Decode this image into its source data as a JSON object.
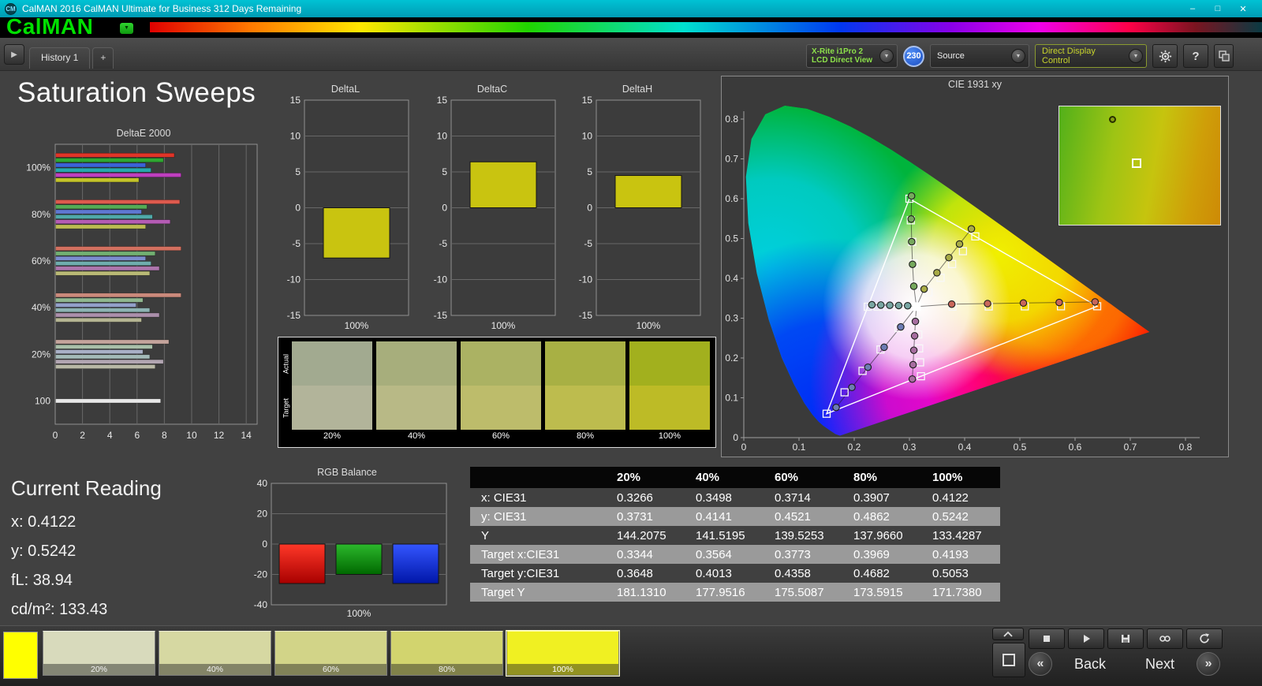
{
  "titlebar": {
    "logo_badge": "CM",
    "title": "CalMAN 2016 CalMAN Ultimate for Business 312 Days Remaining",
    "minimize": "–",
    "maximize": "□",
    "close": "✕"
  },
  "brand": {
    "logo": "CalMAN",
    "menu_arrow": "▼"
  },
  "tabs": {
    "expand_icon": "▶",
    "active": "History 1",
    "add": "+"
  },
  "toolbar": {
    "meter_line1": "X-Rite i1Pro 2",
    "meter_line2": "LCD Direct View",
    "badge": "230",
    "source": "Source",
    "display_control": "Direct Display Control",
    "dropdown_arrow": "▼",
    "help_icon": "?"
  },
  "page_title": "Saturation Sweeps",
  "charts": {
    "deltae": {
      "type": "bar",
      "title": "DeltaE 2000",
      "xticks": [
        0,
        2,
        4,
        6,
        8,
        10,
        12,
        14
      ],
      "xmax": 14.8,
      "groups": [
        {
          "label": "100%",
          "values": [
            8.7,
            7.9,
            6.6,
            7.0,
            9.2,
            6.1
          ],
          "colors": [
            "#e03428",
            "#2fa832",
            "#3b62d8",
            "#27a8ac",
            "#bf3fbf",
            "#c3c32a"
          ]
        },
        {
          "label": "80%",
          "values": [
            9.1,
            6.7,
            6.3,
            7.1,
            8.4,
            6.6
          ],
          "colors": [
            "#de5a4e",
            "#55ab55",
            "#5f78d2",
            "#4fa9a9",
            "#b45cb4",
            "#bcbc52"
          ]
        },
        {
          "label": "60%",
          "values": [
            9.2,
            7.3,
            6.6,
            7.0,
            7.6,
            6.9
          ],
          "colors": [
            "#d3705f",
            "#72b072",
            "#7b8cce",
            "#6fadad",
            "#ad76ad",
            "#b9b975"
          ]
        },
        {
          "label": "40%",
          "values": [
            9.2,
            6.4,
            5.9,
            6.9,
            7.6,
            6.3
          ],
          "colors": [
            "#cb8a7c",
            "#90b790",
            "#93a0ca",
            "#8db3b3",
            "#ab8fab",
            "#b5b593"
          ]
        },
        {
          "label": "20%",
          "values": [
            8.3,
            7.1,
            6.4,
            6.9,
            7.9,
            7.3
          ],
          "colors": [
            "#c4a49c",
            "#a9bfa9",
            "#a8b0c6",
            "#a3bab8",
            "#b2a6b2",
            "#b8b8a6"
          ]
        },
        {
          "label": "100",
          "values": [
            7.7
          ],
          "colors": [
            "#e8e8e8"
          ]
        }
      ]
    },
    "deltaL": {
      "type": "bar",
      "title": "DeltaL",
      "value": -7.0,
      "ylim": [
        -15,
        15
      ],
      "yticks": [
        15,
        10,
        5,
        0,
        -5,
        -10,
        -15
      ],
      "xlabel": "100%",
      "bar_color": "#c9c410"
    },
    "deltaC": {
      "type": "bar",
      "title": "DeltaC",
      "value": 6.4,
      "ylim": [
        -15,
        15
      ],
      "yticks": [
        15,
        10,
        5,
        0,
        -5,
        -10,
        -15
      ],
      "xlabel": "100%",
      "bar_color": "#c9c410"
    },
    "deltaH": {
      "type": "bar",
      "title": "DeltaH",
      "value": 4.5,
      "ylim": [
        -15,
        15
      ],
      "yticks": [
        15,
        10,
        5,
        0,
        -5,
        -10,
        -15
      ],
      "xlabel": "100%",
      "bar_color": "#c9c410"
    },
    "rgb_balance": {
      "type": "bar",
      "title": "RGB Balance",
      "ylim": [
        -40,
        40
      ],
      "yticks": [
        40,
        20,
        0,
        -20,
        -40
      ],
      "xlabel": "100%",
      "bars": [
        {
          "name": "red",
          "value": -26,
          "color_top": "#ff3828",
          "color_bottom": "#a80000"
        },
        {
          "name": "green",
          "value": -20,
          "color_top": "#2cb82c",
          "color_bottom": "#006800"
        },
        {
          "name": "blue",
          "value": -26,
          "color_top": "#3456ff",
          "color_bottom": "#0016a8"
        }
      ]
    }
  },
  "swatch_panel": {
    "row_labels": [
      "Actual",
      "Target"
    ],
    "items": [
      {
        "label": "20%",
        "actual": "#a2aa90",
        "target": "#b2b49a"
      },
      {
        "label": "40%",
        "actual": "#a7ae7c",
        "target": "#b8b986"
      },
      {
        "label": "60%",
        "actual": "#abb263",
        "target": "#bdbc6b"
      },
      {
        "label": "80%",
        "actual": "#a8b044",
        "target": "#bdbc4e"
      },
      {
        "label": "100%",
        "actual": "#a2b01e",
        "target": "#bdbb26"
      }
    ]
  },
  "cie": {
    "title": "CIE 1931 xy",
    "xticks": [
      0,
      0.1,
      0.2,
      0.3,
      0.4,
      0.5,
      0.6,
      0.7,
      0.8
    ],
    "yticks": [
      0,
      0.1,
      0.2,
      0.3,
      0.4,
      0.5,
      0.6,
      0.7,
      0.8
    ],
    "white_point": [
      0.3127,
      0.329
    ],
    "gamut_triangle": [
      [
        0.64,
        0.33
      ],
      [
        0.3,
        0.6
      ],
      [
        0.15,
        0.06
      ]
    ],
    "sweeps": [
      {
        "name": "red",
        "fill": "#c9675b",
        "targets": [
          [
            0.3781,
            0.329
          ],
          [
            0.4436,
            0.3294
          ],
          [
            0.509,
            0.3296
          ],
          [
            0.5745,
            0.3298
          ],
          [
            0.64,
            0.33
          ]
        ],
        "measured": [
          [
            0.3766,
            0.3352
          ],
          [
            0.4415,
            0.3366
          ],
          [
            0.5064,
            0.338
          ],
          [
            0.5713,
            0.3394
          ],
          [
            0.6362,
            0.3408
          ]
        ]
      },
      {
        "name": "green",
        "fill": "#76a95d",
        "targets": [
          [
            0.3102,
            0.3832
          ],
          [
            0.3076,
            0.4374
          ],
          [
            0.3051,
            0.4916
          ],
          [
            0.3025,
            0.5458
          ],
          [
            0.3,
            0.6
          ]
        ],
        "measured": [
          [
            0.3079,
            0.3802
          ],
          [
            0.3056,
            0.4352
          ],
          [
            0.3041,
            0.492
          ],
          [
            0.3032,
            0.549
          ],
          [
            0.3038,
            0.6068
          ]
        ]
      },
      {
        "name": "blue",
        "fill": "#6d7cb4",
        "targets": [
          [
            0.2802,
            0.2752
          ],
          [
            0.2476,
            0.2214
          ],
          [
            0.2151,
            0.1676
          ],
          [
            0.1825,
            0.1138
          ],
          [
            0.15,
            0.06
          ]
        ],
        "measured": [
          [
            0.2842,
            0.278
          ],
          [
            0.2542,
            0.227
          ],
          [
            0.2248,
            0.1768
          ],
          [
            0.1958,
            0.1262
          ],
          [
            0.1672,
            0.0758
          ]
        ]
      },
      {
        "name": "cyan",
        "fill": "#79a6a3",
        "targets": [
          [
            0.2951,
            0.3289
          ],
          [
            0.2775,
            0.3289
          ],
          [
            0.2599,
            0.3288
          ],
          [
            0.2422,
            0.3288
          ],
          [
            0.2246,
            0.3287
          ]
        ],
        "measured": [
          [
            0.2968,
            0.3312
          ],
          [
            0.2806,
            0.3318
          ],
          [
            0.2644,
            0.3324
          ],
          [
            0.2482,
            0.333
          ],
          [
            0.232,
            0.3336
          ]
        ]
      },
      {
        "name": "magenta",
        "fill": "#a76da0",
        "targets": [
          [
            0.3143,
            0.294
          ],
          [
            0.316,
            0.259
          ],
          [
            0.3176,
            0.2241
          ],
          [
            0.3193,
            0.1891
          ],
          [
            0.3209,
            0.1542
          ]
        ],
        "measured": [
          [
            0.3108,
            0.2918
          ],
          [
            0.3094,
            0.2556
          ],
          [
            0.308,
            0.2194
          ],
          [
            0.3066,
            0.1832
          ],
          [
            0.3052,
            0.147
          ]
        ]
      },
      {
        "name": "yellow",
        "fill": "#a8ab46",
        "targets": [
          [
            0.3344,
            0.3648
          ],
          [
            0.3564,
            0.4013
          ],
          [
            0.3773,
            0.4358
          ],
          [
            0.3969,
            0.4682
          ],
          [
            0.4193,
            0.5053
          ]
        ],
        "measured": [
          [
            0.3266,
            0.3731
          ],
          [
            0.3498,
            0.4141
          ],
          [
            0.3714,
            0.4521
          ],
          [
            0.3907,
            0.4862
          ],
          [
            0.4122,
            0.5242
          ]
        ]
      }
    ]
  },
  "current_reading": {
    "title": "Current Reading",
    "lines": [
      {
        "label": "x:",
        "value": "0.4122"
      },
      {
        "label": "y:",
        "value": "0.5242"
      },
      {
        "label": "fL:",
        "value": "38.94"
      },
      {
        "label": "cd/m²:",
        "value": "133.43"
      }
    ]
  },
  "table": {
    "columns": [
      "20%",
      "40%",
      "60%",
      "80%",
      "100%"
    ],
    "rows": [
      {
        "label": "x: CIE31",
        "values": [
          "0.3266",
          "0.3498",
          "0.3714",
          "0.3907",
          "0.4122"
        ]
      },
      {
        "label": "y: CIE31",
        "values": [
          "0.3731",
          "0.4141",
          "0.4521",
          "0.4862",
          "0.5242"
        ]
      },
      {
        "label": "Y",
        "values": [
          "144.2075",
          "141.5195",
          "139.5253",
          "137.9660",
          "133.4287"
        ]
      },
      {
        "label": "Target x:CIE31",
        "values": [
          "0.3344",
          "0.3564",
          "0.3773",
          "0.3969",
          "0.4193"
        ]
      },
      {
        "label": "Target y:CIE31",
        "values": [
          "0.3648",
          "0.4013",
          "0.4358",
          "0.4682",
          "0.5053"
        ]
      },
      {
        "label": "Target Y",
        "values": [
          "181.1310",
          "177.9516",
          "175.5087",
          "173.5915",
          "171.7380"
        ]
      }
    ]
  },
  "bottom": {
    "current_swatch_color": "#ffff00",
    "patches": [
      {
        "label": "20%",
        "color": "#d8dabc"
      },
      {
        "label": "40%",
        "color": "#d6d8a2"
      },
      {
        "label": "60%",
        "color": "#d2d488"
      },
      {
        "label": "80%",
        "color": "#d2d46e"
      },
      {
        "label": "100%",
        "color": "#e2e220",
        "selected": true
      }
    ],
    "transport": [
      "stop",
      "play",
      "save",
      "loop",
      "refresh"
    ],
    "prev_icon": "«",
    "back_label": "Back",
    "next_label": "Next",
    "next_icon": "»"
  }
}
